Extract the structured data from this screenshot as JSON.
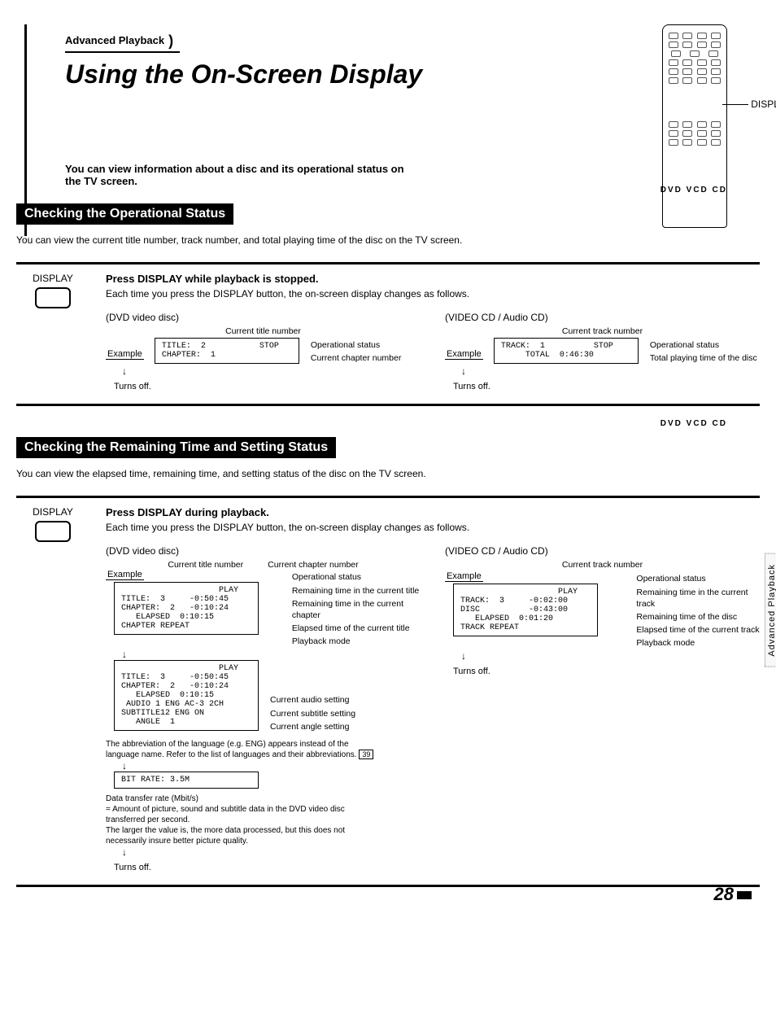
{
  "header": {
    "section_tag": "Advanced Playback",
    "title": "Using the On-Screen Display",
    "intro": "You can view information about a disc and its operational status on the TV screen.",
    "remote_callout": "DISPLAY"
  },
  "badges_line": "DVD   VCD   CD",
  "sec1": {
    "bar": "Checking the Operational Status",
    "desc": "You can view the current title number, track number, and total playing time of the disc on the TV screen.",
    "button_label": "DISPLAY",
    "instr_heading": "Press DISPLAY while playback is stopped.",
    "instr_sub": "Each time you press the DISPLAY button, the on-screen display changes as follows.",
    "dvd": {
      "disc_type": "(DVD video disc)",
      "header_center": "Current title number",
      "example_label": "Example",
      "osd": "TITLE:  2           STOP\nCHAPTER:  1",
      "callouts": [
        "Operational status",
        "Current chapter number"
      ],
      "turns_off": "Turns off."
    },
    "vcd": {
      "disc_type": "(VIDEO CD / Audio CD)",
      "header_center": "Current track number",
      "example_label": "Example",
      "osd": "TRACK:  1          STOP\n     TOTAL  0:46:30",
      "callouts": [
        "Operational status",
        "Total playing time of the disc"
      ],
      "turns_off": "Turns off."
    }
  },
  "sec2": {
    "bar": "Checking the Remaining Time and Setting Status",
    "desc": "You can view the elapsed time, remaining time, and setting status of the disc on the TV screen.",
    "button_label": "DISPLAY",
    "instr_heading": "Press DISPLAY during playback.",
    "instr_sub": "Each time you press the DISPLAY button, the on-screen display changes as follows.",
    "dvd": {
      "disc_type": "(DVD video disc)",
      "header_c1": "Current title number",
      "header_c2": "Current chapter number",
      "example_label": "Example",
      "osd1": "                    PLAY\nTITLE:  3     -0:50:45\nCHAPTER:  2   -0:10:24\n   ELAPSED  0:10:15\nCHAPTER REPEAT",
      "callouts1": [
        "Operational status",
        "Remaining time in the current title",
        "Remaining time in the current chapter",
        "Elapsed time of the current title",
        "Playback mode"
      ],
      "osd2": "                    PLAY\nTITLE:  3     -0:50:45\nCHAPTER:  2   -0:10:24\n   ELAPSED  0:10:15\n AUDIO 1 ENG AC-3 2CH\nSUBTITLE12 ENG ON\n   ANGLE  1",
      "callouts2": [
        "Current audio setting",
        "Current subtitle setting",
        "Current angle setting"
      ],
      "lang_note_a": "The abbreviation of the language (e.g. ENG) appears instead of the language name. Refer to the list of languages and their abbreviations.",
      "lang_note_ref": "39",
      "osd3": "BIT RATE: 3.5M",
      "bitrate_note": "Data transfer rate (Mbit/s)\n= Amount of picture, sound and subtitle data in the DVD video disc transferred per second.\nThe larger the value is, the more data processed, but this does not necessarily insure better picture quality.",
      "turns_off": "Turns off."
    },
    "vcd": {
      "disc_type": "(VIDEO CD / Audio CD)",
      "header_center": "Current track number",
      "example_label": "Example",
      "osd": "                    PLAY\nTRACK:  3     -0:02:00\nDISC          -0:43:00\n   ELAPSED  0:01:20\nTRACK REPEAT",
      "callouts": [
        "Operational status",
        "Remaining time in the current track",
        "Remaining time of the disc",
        "Elapsed time of the current track",
        "Playback mode"
      ],
      "turns_off": "Turns off."
    }
  },
  "page_number": "28",
  "side_tab": "Advanced Playback"
}
